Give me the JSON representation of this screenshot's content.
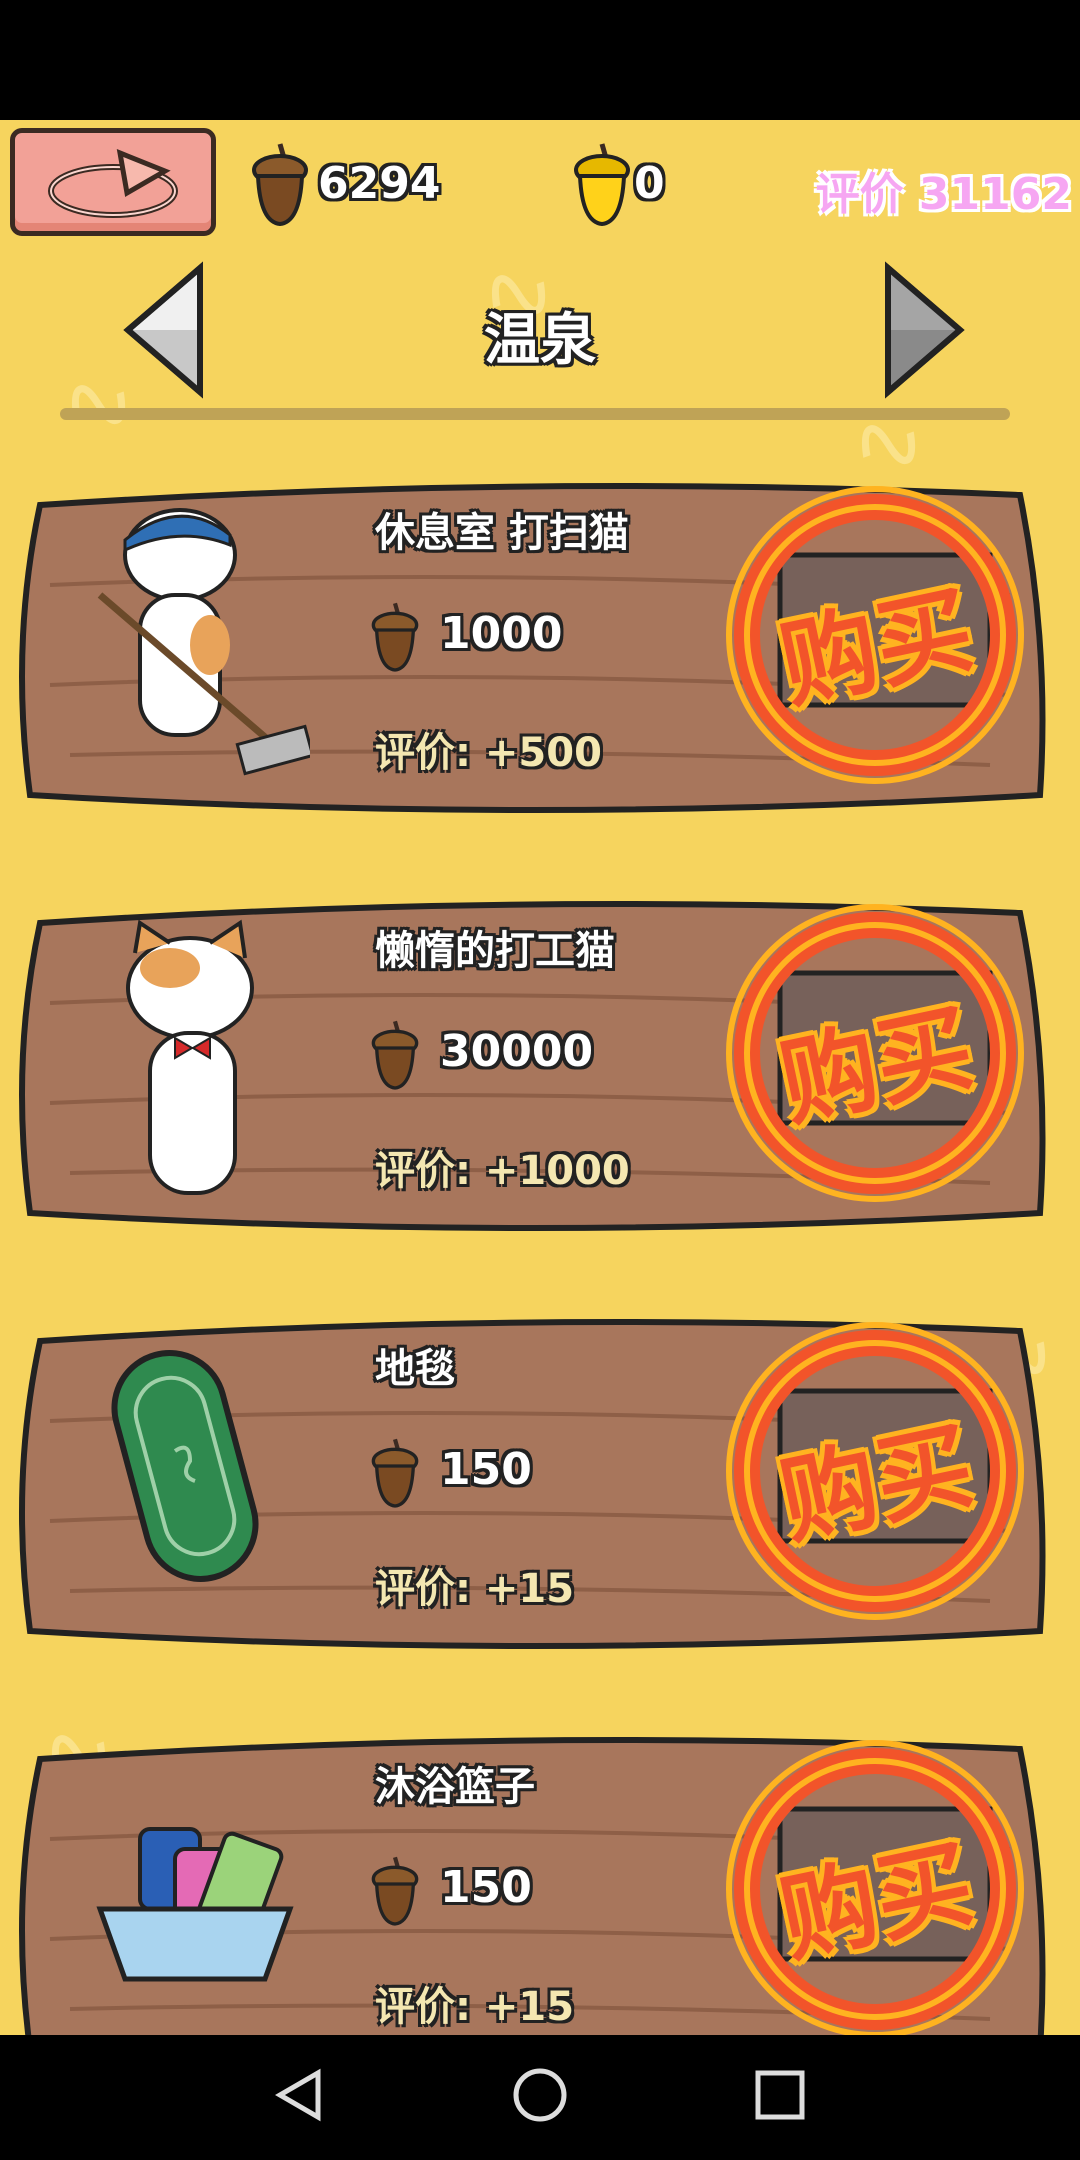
{
  "header": {
    "back_icon": "undo-arrow-icon",
    "acorns_brown": "6294",
    "acorns_gold": "0",
    "rating": "评价 31162",
    "title": "温泉"
  },
  "items": [
    {
      "name": "休息室 打扫猫",
      "price": "1000",
      "rating_gain": "评价: +500",
      "icon": "cleaning-cat-icon",
      "buy_label": "购买"
    },
    {
      "name": "懒惰的打工猫",
      "price": "30000",
      "rating_gain": "评价: +1000",
      "icon": "lazy-cat-icon",
      "buy_label": "购买"
    },
    {
      "name": "地毯",
      "price": "150",
      "rating_gain": "评价: +15",
      "icon": "carpet-icon",
      "buy_label": "购买"
    },
    {
      "name": "沐浴篮子",
      "price": "150",
      "rating_gain": "评价: +15",
      "icon": "bath-basket-icon",
      "buy_label": "购买"
    }
  ],
  "colors": {
    "background": "#f6d45e",
    "wood": "#a8765c",
    "buy_red": "#f2542a",
    "rating_pink": "#f6a6f2"
  }
}
